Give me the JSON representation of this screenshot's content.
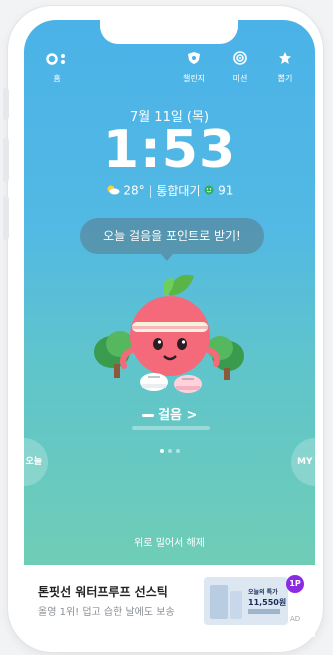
{
  "topbar": {
    "home_label": "홈",
    "items": [
      {
        "label": "챌린지",
        "icon": "shield-icon"
      },
      {
        "label": "미션",
        "icon": "target-icon"
      },
      {
        "label": "뽑기",
        "icon": "gift-icon"
      }
    ]
  },
  "lockscreen": {
    "date": "7월 11일 (목)",
    "time": "1:53",
    "temperature": "28°",
    "air_quality_label": "통합대기",
    "air_quality_value": "91",
    "bubble_text": "오늘 걸음을 포인트로 받기!",
    "steps_label": "걸음 >",
    "left_button": "오늘",
    "right_button": "MY",
    "unlock_text": "위로 밀어서 해제"
  },
  "ad": {
    "title": "톤핏선 워터프루프 선스틱",
    "subtitle": "올영 1위! 덥고 습한 날에도 보송",
    "thumb_title": "오늘의 특가",
    "thumb_price": "11,550원",
    "badge": "1P",
    "label": "AD"
  },
  "colors": {
    "sky_top": "#4bb2e8",
    "sky_bottom": "#6fcdb6",
    "badge": "#8a2be2"
  },
  "pagination": {
    "count": 3,
    "active": 0
  }
}
